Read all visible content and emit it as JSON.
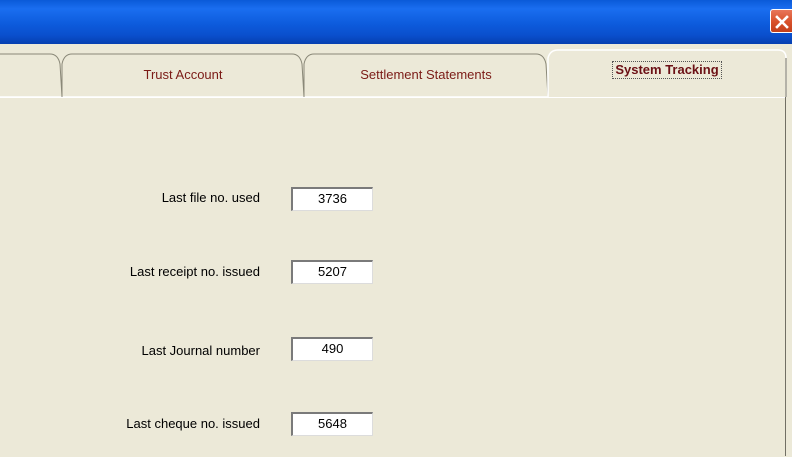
{
  "tabs": [
    {
      "label": "Trust Account"
    },
    {
      "label": "Settlement Statements"
    },
    {
      "label": "System Tracking",
      "active": true
    }
  ],
  "fields": [
    {
      "label": "Last file no. used",
      "value": "3736"
    },
    {
      "label": "Last receipt no. issued",
      "value": "5207"
    },
    {
      "label": "Last Journal number",
      "value": "490"
    },
    {
      "label": "Last cheque no. issued",
      "value": "5648"
    }
  ],
  "icons": {
    "close": "close-x-icon"
  }
}
